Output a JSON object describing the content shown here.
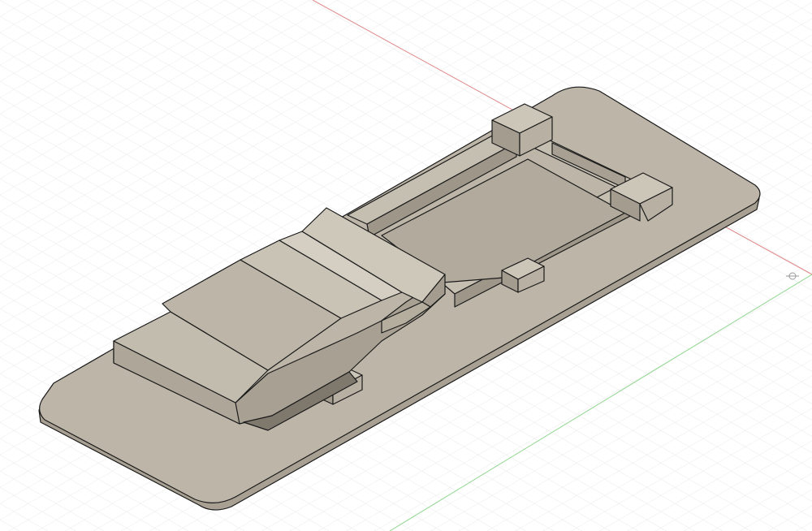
{
  "viewport": {
    "background": "#ffffff",
    "grid_minor_color": "#e6e6e6",
    "grid_major_color": "#cfcfcf"
  },
  "axes": {
    "x_axis_color": "#e08a8a",
    "y_axis_color": "#8fd68f",
    "origin_marker": "origin-icon"
  },
  "model": {
    "body_color": "#bdb6a8",
    "body_top_color": "#c8c2b4",
    "body_side_color": "#a8a193",
    "body_dark_color": "#8f897c",
    "edge_color": "#1a1a1a"
  }
}
